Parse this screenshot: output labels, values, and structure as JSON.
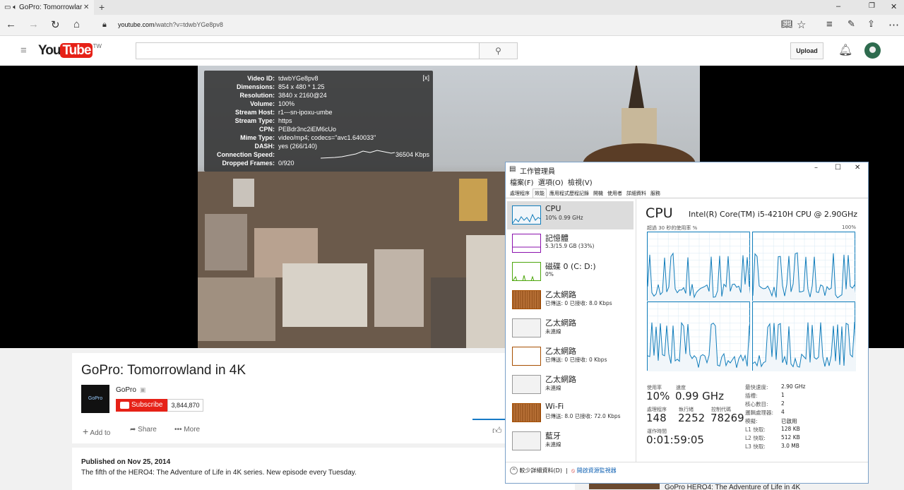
{
  "browser": {
    "tab_title": "GoPro: Tomorrowlar",
    "url_domain": "youtube.com",
    "url_path": "/watch?v=tdwbYGe8pv8"
  },
  "youtube": {
    "logo_text": "You",
    "logo_tube": "Tube",
    "region": "TW",
    "search_placeholder": "",
    "upload_label": "Upload",
    "video_title": "GoPro: Tomorrowland in 4K",
    "channel_name": "GoPro",
    "channel_logo": "GoPro",
    "subscribe_label": "Subscribe",
    "subscriber_count": "3,844,870",
    "add_to_label": "Add to",
    "share_label": "Share",
    "more_label": "More",
    "published": "Published on Nov 25, 2014",
    "description": "The fifth of the HERO4: The Adventure of Life in 4K series. New episode every Tuesday.",
    "related_title_partial": "GoPro HERO4: The Adventure of Life in 4K"
  },
  "stats_for_nerds": {
    "close": "[x]",
    "rows": [
      {
        "key": "Video ID:",
        "value": "tdwbYGe8pv8"
      },
      {
        "key": "Dimensions:",
        "value": "854 x 480 * 1.25"
      },
      {
        "key": "Resolution:",
        "value": "3840 x 2160@24"
      },
      {
        "key": "Volume:",
        "value": "100%"
      },
      {
        "key": "Stream Host:",
        "value": "r1---sn-ipoxu-umbe"
      },
      {
        "key": "Stream Type:",
        "value": "https"
      },
      {
        "key": "CPN:",
        "value": "PEBdr3nc2iEM6cUo"
      },
      {
        "key": "Mime Type:",
        "value": "video/mp4; codecs=\"avc1.640033\""
      },
      {
        "key": "DASH:",
        "value": "yes (266/140)"
      },
      {
        "key": "Connection Speed:",
        "value": "36504 Kbps"
      },
      {
        "key": "Dropped Frames:",
        "value": "0/920"
      }
    ]
  },
  "task_manager": {
    "title": "工作管理員",
    "menu": [
      "檔案(F)",
      "選項(O)",
      "檢視(V)"
    ],
    "tabs": [
      "處理程序",
      "效能",
      "應用程式歷程記錄",
      "開機",
      "使用者",
      "詳細資料",
      "服務"
    ],
    "active_tab": "效能",
    "sidebar": [
      {
        "name": "CPU",
        "sub": "10% 0.99 GHz"
      },
      {
        "name": "記憶體",
        "sub": "5.3/15.9 GB (33%)"
      },
      {
        "name": "磁碟 0 (C: D:)",
        "sub": "0%"
      },
      {
        "name": "乙太網路",
        "sub": "已傳送: 0 已接收: 8.0 Kbps"
      },
      {
        "name": "乙太網路",
        "sub": "未連線"
      },
      {
        "name": "乙太網路",
        "sub": "已傳送: 0 已接收: 0 Kbps"
      },
      {
        "name": "乙太網路",
        "sub": "未連線"
      },
      {
        "name": "Wi-Fi",
        "sub": "已傳送: 8.0 已接收: 72.0 Kbps"
      },
      {
        "name": "藍牙",
        "sub": "未連線"
      }
    ],
    "cpu_heading": "CPU",
    "cpu_model": "Intel(R) Core(TM) i5-4210H CPU @ 2.90GHz",
    "util_label": "超過 30 秒的使用率 %",
    "util_max": "100%",
    "usage_label": "使用率",
    "usage_value": "10%",
    "speed_label": "速度",
    "speed_value": "0.99 GHz",
    "proc_label": "處理程序",
    "proc_value": "148",
    "threads_label": "執行緒",
    "threads_value": "2252",
    "handles_label": "控制代碼",
    "handles_value": "78269",
    "uptime_label": "運作時間",
    "uptime_value": "0:01:59:05",
    "specs": [
      {
        "k": "最快速度:",
        "v": "2.90 GHz"
      },
      {
        "k": "插槽:",
        "v": "1"
      },
      {
        "k": "核心數目:",
        "v": "2"
      },
      {
        "k": "邏輯處理器:",
        "v": "4"
      },
      {
        "k": "模擬:",
        "v": "已啟用"
      },
      {
        "k": "L1 快取:",
        "v": "128 KB"
      },
      {
        "k": "L2 快取:",
        "v": "512 KB"
      },
      {
        "k": "L3 快取:",
        "v": "3.0 MB"
      }
    ],
    "fewer_details": "較少詳細資料(D)",
    "open_monitor": "開啟資源監視器"
  }
}
